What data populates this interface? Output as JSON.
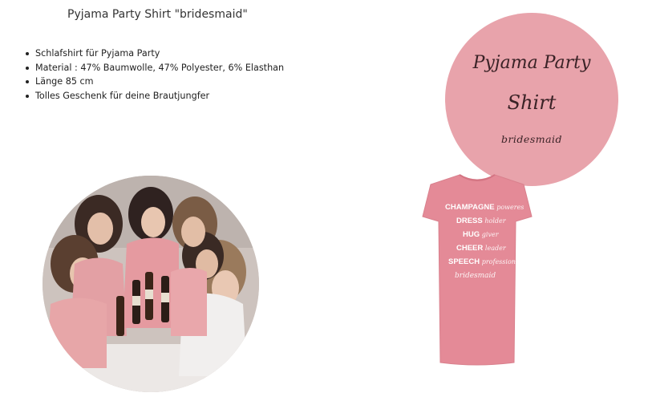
{
  "title": "Pyjama Party Shirt \"bridesmaid\"",
  "bullets": [
    "Schlafshirt für Pyjama Party",
    "Material : 47% Baumwolle, 47% Polyester, 6% Elasthan",
    "Länge 85 cm",
    "Tolles Geschenk für deine Brautjungfer"
  ],
  "badge": {
    "line1": "Pyjama Party",
    "line2": "Shirt",
    "line3": "bridesmaid",
    "color": "#e8a3ab"
  },
  "shirt_print": [
    {
      "bold": "CHAMPAGNE",
      "script": "poweres"
    },
    {
      "bold": "DRESS",
      "script": "holder"
    },
    {
      "bold": "HUG",
      "script": "giver"
    },
    {
      "bold": "CHEER",
      "script": "leader"
    },
    {
      "bold": "SPEECH",
      "script": "professional"
    },
    {
      "bold": "",
      "script": "bridesmaid"
    }
  ],
  "shirt_color": "#e48a97"
}
